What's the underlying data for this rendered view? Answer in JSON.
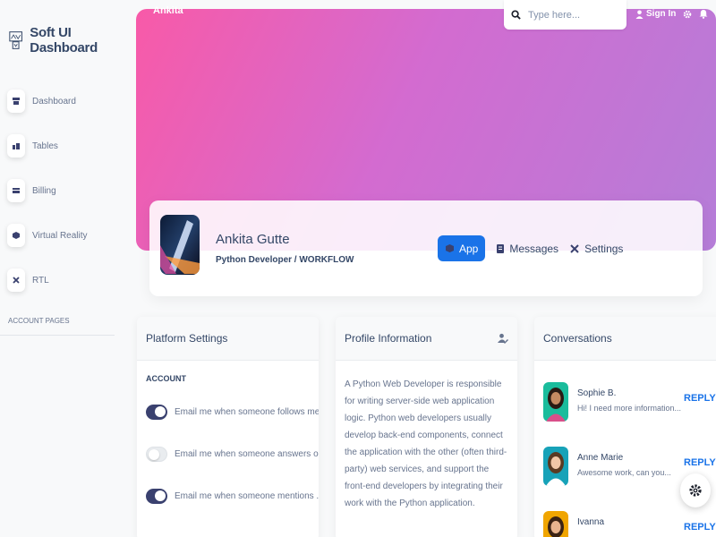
{
  "brand": {
    "title": "Soft UI Dashboard"
  },
  "sidebar": {
    "items": [
      {
        "label": "Dashboard"
      },
      {
        "label": "Tables"
      },
      {
        "label": "Billing"
      },
      {
        "label": "Virtual Reality"
      },
      {
        "label": "RTL"
      }
    ],
    "section_title": "ACCOUNT PAGES"
  },
  "header": {
    "breadcrumb_title": "Ankita",
    "search_placeholder": "Type here...",
    "signin_label": "Sign In"
  },
  "profile": {
    "name": "Ankita Gutte",
    "role": "Python Developer / WORKFLOW",
    "tabs": [
      {
        "label": "App",
        "active": true
      },
      {
        "label": "Messages",
        "active": false
      },
      {
        "label": "Settings",
        "active": false
      }
    ]
  },
  "platform_settings": {
    "title": "Platform Settings",
    "section": "ACCOUNT",
    "items": [
      {
        "label": "Email me when someone follows me",
        "enabled": true
      },
      {
        "label": "Email me when someone answers o...",
        "enabled": false
      },
      {
        "label": "Email me when someone mentions ...",
        "enabled": true
      }
    ]
  },
  "profile_information": {
    "title": "Profile Information",
    "description": "A Python Web Developer is responsible for writing server-side web application logic. Python web developers usually develop back-end components, connect the application with the other (often third-party) web services, and support the front-end developers by integrating their work with the Python application."
  },
  "conversations": {
    "title": "Conversations",
    "items": [
      {
        "name": "Sophie B.",
        "message": "Hi! I need more information...",
        "action": "REPLY"
      },
      {
        "name": "Anne Marie",
        "message": "Awesome work, can you...",
        "action": "REPLY"
      },
      {
        "name": "Ivanna",
        "message": "",
        "action": "REPLY"
      }
    ]
  },
  "colors": {
    "primary": "#1a73e8",
    "text": "#344767",
    "muted": "#67748e",
    "toggle_on": "#3a416f",
    "hero_start": "#f85aa8",
    "hero_end": "#b57dd8"
  },
  "icons": {
    "brand": "logo-icon",
    "dashboard": "shop-icon",
    "tables": "office-icon",
    "billing": "credit-card-icon",
    "virtual_reality": "box-icon",
    "rtl": "tools-icon",
    "search": "search-icon",
    "signin": "user-icon",
    "settings": "gear-icon",
    "notifications": "bell-icon",
    "app_tab": "cube-icon",
    "messages_tab": "document-icon",
    "settings_tab": "tools-icon",
    "edit_profile": "user-edit-icon",
    "configurator": "gear-icon"
  }
}
